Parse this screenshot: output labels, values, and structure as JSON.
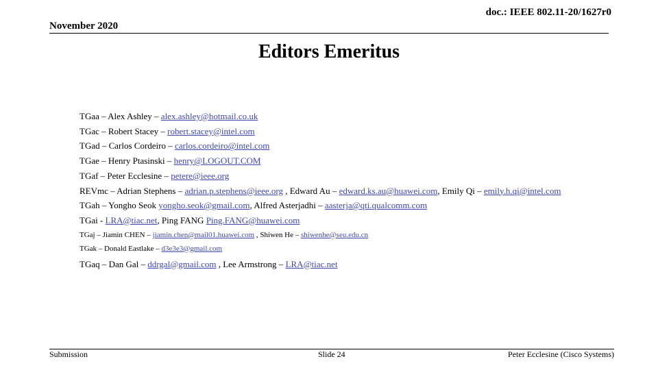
{
  "header": {
    "doc_id": "doc.: IEEE 802.11-20/1627r0",
    "date": "November 2020"
  },
  "title": "Editors Emeritus",
  "entries": [
    {
      "segments": [
        {
          "text": "TGaa – Alex Ashley – ",
          "link": false
        },
        {
          "text": "alex.ashley@hotmail.co.uk",
          "link": true
        }
      ]
    },
    {
      "segments": [
        {
          "text": "TGac – Robert Stacey – ",
          "link": false
        },
        {
          "text": "robert.stacey@intel.com",
          "link": true
        }
      ]
    },
    {
      "segments": [
        {
          "text": "TGad – Carlos Cordeiro – ",
          "link": false
        },
        {
          "text": "carlos.cordeiro@intel.com",
          "link": true
        }
      ]
    },
    {
      "segments": [
        {
          "text": "TGae – Henry Ptasinski – ",
          "link": false
        },
        {
          "text": "henry@LOGOUT.COM",
          "link": true
        }
      ]
    },
    {
      "segments": [
        {
          "text": "TGaf – Peter Ecclesine – ",
          "link": false
        },
        {
          "text": "petere@ieee.org",
          "link": true
        }
      ]
    },
    {
      "segments": [
        {
          "text": "REVmc – Adrian Stephens – ",
          "link": false
        },
        {
          "text": "adrian.p.stephens@ieee.org",
          "link": true
        },
        {
          "text": " , Edward Au – ",
          "link": false
        },
        {
          "text": "edward.ks.au@huawei.com",
          "link": true
        },
        {
          "text": ", Emily Qi – ",
          "link": false
        },
        {
          "text": "emily.h.qi@intel.com",
          "link": true
        }
      ]
    },
    {
      "segments": [
        {
          "text": "TGah – Yongho Seok ",
          "link": false
        },
        {
          "text": "yongho.seok@gmail.com",
          "link": true
        },
        {
          "text": ", Alfred Asterjadhi – ",
          "link": false
        },
        {
          "text": "aasterja@qti.qualcomm.com",
          "link": true
        }
      ]
    },
    {
      "segments": [
        {
          "text": "TGai - ",
          "link": false
        },
        {
          "text": "LRA@tiac.net",
          "link": true
        },
        {
          "text": ", Ping FANG ",
          "link": false
        },
        {
          "text": "Ping.FANG@huawei.com",
          "link": true
        }
      ]
    },
    {
      "size": "sm",
      "segments": [
        {
          "text": "TGaj – Jiamin CHEN – ",
          "link": false
        },
        {
          "text": "jiamin.chen@mail01.huawei.com",
          "link": true
        },
        {
          "text": " , Shiwen He – ",
          "link": false
        },
        {
          "text": "shiwenhe@seu.edu.cn",
          "link": true
        }
      ]
    },
    {
      "size": "sm",
      "segments": [
        {
          "text": "TGak – Donald Eastlake – ",
          "link": false
        },
        {
          "text": "d3e3e3@gmail.com",
          "link": true
        }
      ]
    },
    {
      "size": "last",
      "segments": [
        {
          "text": "TGaq – Dan Gal – ",
          "link": false
        },
        {
          "text": "ddrgal@gmail.com",
          "link": true
        },
        {
          "text": " , Lee Armstrong – ",
          "link": false
        },
        {
          "text": "LRA@tiac.net",
          "link": true
        }
      ]
    }
  ],
  "footer": {
    "left": "Submission",
    "center": "Slide 24",
    "right": "Peter Ecclesine (Cisco Systems)"
  },
  "colors": {
    "link": "#3f49a6",
    "text": "#000000",
    "background": "#ffffff"
  }
}
